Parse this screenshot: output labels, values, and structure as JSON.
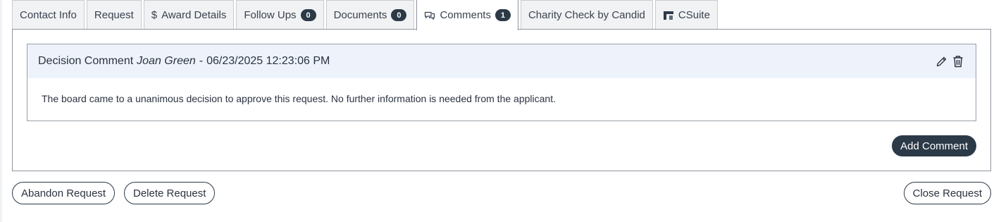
{
  "tabs": [
    {
      "label": "Contact Info"
    },
    {
      "label": "Request"
    },
    {
      "label": "Award Details",
      "icon": "dollar-icon"
    },
    {
      "label": "Follow Ups",
      "badge": "0"
    },
    {
      "label": "Documents",
      "badge": "0"
    },
    {
      "label": "Comments",
      "badge": "1",
      "icon": "comments-icon",
      "active": true
    },
    {
      "label": "Charity Check by Candid"
    },
    {
      "label": "CSuite",
      "icon": "csuite-logo-icon"
    }
  ],
  "comment": {
    "title": "Decision Comment",
    "author": "Joan Green",
    "separator": "-",
    "timestamp": "06/23/2025 12:23:06 PM",
    "body": "The board came to a unanimous decision to approve this request. No further information is needed from the applicant.",
    "edit_icon": "pencil-icon",
    "delete_icon": "trash-icon"
  },
  "actions": {
    "add_comment": "Add Comment",
    "abandon_request": "Abandon Request",
    "delete_request": "Delete Request",
    "close_request": "Close Request"
  },
  "colors": {
    "primary_dark": "#2c3947",
    "header_bg": "#eef3fb",
    "tab_bg": "#f1f2f4"
  }
}
